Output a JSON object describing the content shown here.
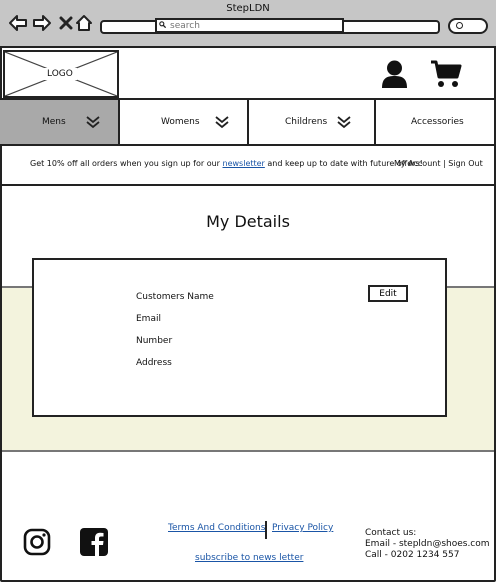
{
  "window": {
    "title": "StepLDN"
  },
  "header": {
    "logo_text": "LOGO",
    "search_placeholder": "search"
  },
  "nav": {
    "items": [
      {
        "label": "Mens"
      },
      {
        "label": "Womens"
      },
      {
        "label": "Childrens"
      },
      {
        "label": "Accessories"
      }
    ]
  },
  "promo": {
    "text_before": "Get 10% off all orders when you sign up for our ",
    "link": "newsletter",
    "text_after": " and keep up to date with future offers!",
    "account": "My Account | Sign Out"
  },
  "main": {
    "title": "My Details",
    "fields": [
      "Customers Name",
      "Email",
      "Number",
      "Address"
    ],
    "edit_label": "Edit"
  },
  "footer": {
    "terms": "Terms And Conditions",
    "privacy": "Privacy Policy",
    "subscribe": "subscribe to news letter",
    "contact_heading": "Contact us:",
    "contact_email": "Email - stepldn@shoes.com",
    "contact_call": "Call - 0202 1234 557"
  },
  "colors": {
    "chrome": "#c6c6c6",
    "active_nav": "#a9a9a9",
    "band": "#f3f3dd",
    "link": "#1a55a6"
  }
}
